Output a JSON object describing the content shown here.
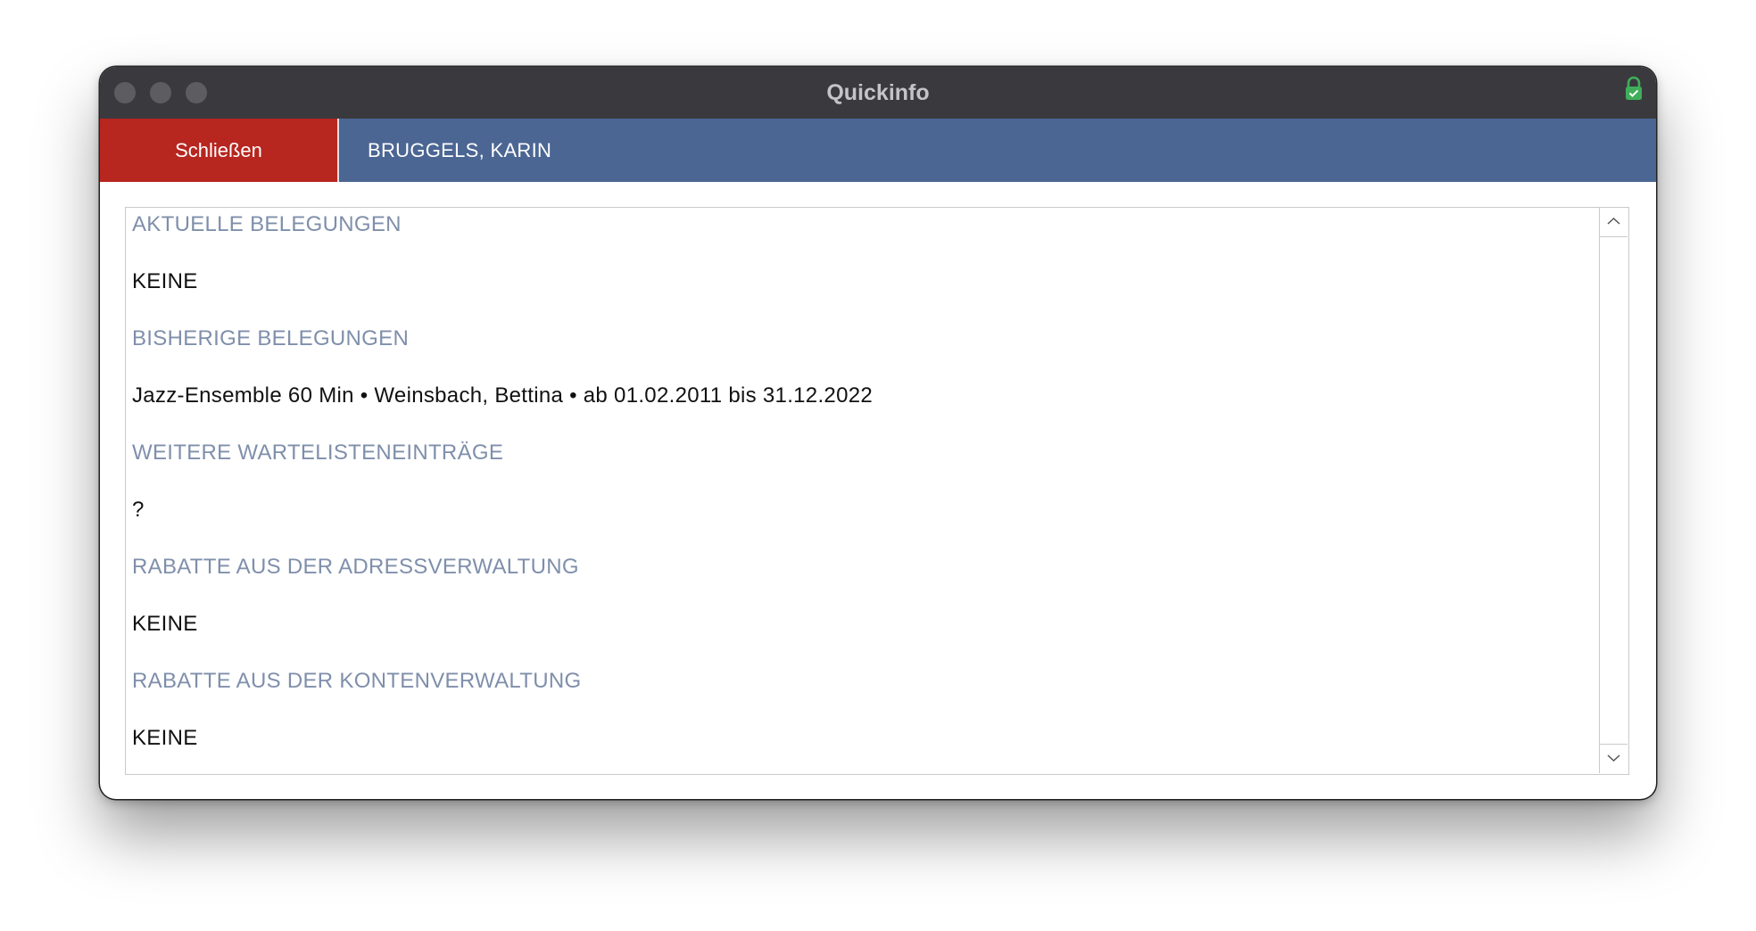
{
  "window": {
    "title": "Quickinfo",
    "lock_icon": "lock-icon"
  },
  "toolbar": {
    "close_label": "Schließen",
    "person_name": "BRUGGELS, KARIN"
  },
  "colors": {
    "titlebar": "#3a3a3e",
    "toolbar": "#4b6693",
    "close_button": "#b7261f",
    "heading_text": "#7f8fab",
    "lock_icon": "#3fae5a"
  },
  "sections": [
    {
      "heading": "AKTUELLE BELEGUNGEN",
      "value": "KEINE"
    },
    {
      "heading": "BISHERIGE BELEGUNGEN",
      "value": "Jazz-Ensemble 60 Min  •  Weinsbach, Bettina  •  ab 01.02.2011 bis 31.12.2022"
    },
    {
      "heading": "WEITERE WARTELISTENEINTRÄGE",
      "value": "?"
    },
    {
      "heading": "RABATTE AUS DER ADRESSVERWALTUNG",
      "value": "KEINE"
    },
    {
      "heading": "RABATTE AUS DER KONTENVERWALTUNG",
      "value": "KEINE"
    }
  ]
}
